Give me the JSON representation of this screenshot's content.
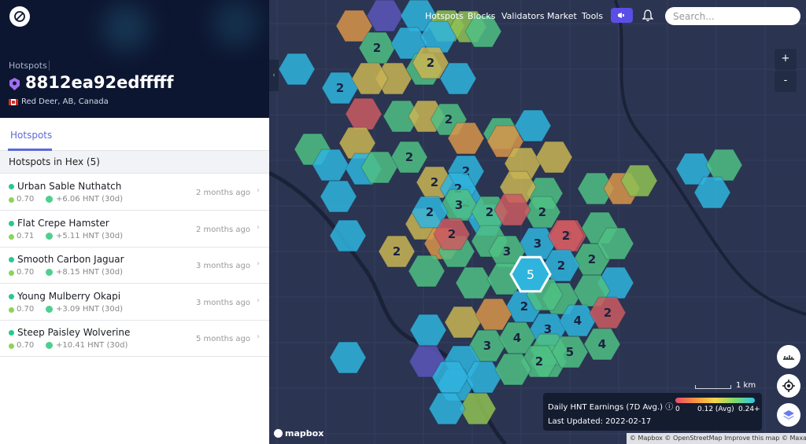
{
  "panel": {
    "breadcrumb": "Hotspots",
    "hotspot_name": "8812ea92edfffff",
    "location": "Red Deer, AB, Canada",
    "tab": "Hotspots",
    "list_title": "Hotspots in Hex (5)",
    "rows": [
      {
        "name": "Urban Sable Nuthatch",
        "scale": "0.70",
        "hnt": "+6.06 HNT (30d)",
        "age": "2 months ago"
      },
      {
        "name": "Flat Crepe Hamster",
        "scale": "0.71",
        "hnt": "+5.11 HNT (30d)",
        "age": "2 months ago"
      },
      {
        "name": "Smooth Carbon Jaguar",
        "scale": "0.70",
        "hnt": "+8.15 HNT (30d)",
        "age": "3 months ago"
      },
      {
        "name": "Young Mulberry Okapi",
        "scale": "0.70",
        "hnt": "+3.09 HNT (30d)",
        "age": "3 months ago"
      },
      {
        "name": "Steep Paisley Wolverine",
        "scale": "0.70",
        "hnt": "+10.41 HNT (30d)",
        "age": "5 months ago"
      }
    ]
  },
  "nav": {
    "items": [
      "Hotspots",
      "Blocks",
      "Validators",
      "Market",
      "Tools"
    ],
    "search_placeholder": "Search..."
  },
  "map": {
    "zoom_in": "+",
    "zoom_out": "-",
    "scale_label": "1 km",
    "legend": {
      "title": "Daily HNT Earnings (7D Avg.) ⓘ",
      "min": "0",
      "avg": "0.12 (Avg)",
      "max": "0.24+",
      "updated": "Last Updated: 2022-02-17"
    },
    "mapbox": "mapbox",
    "attribution": "© Mapbox © OpenStreetMap  Improve this map  © Maxar",
    "selected_hex_count": "5",
    "hex_colors": {
      "blue": "#2fb4de",
      "green": "#4fbf84",
      "lgreen": "#8fc154",
      "yellow": "#c9b453",
      "orange": "#d8944a",
      "red": "#cb5a62",
      "purple": "#5a56b8"
    },
    "hexes": [
      {
        "c": "orange",
        "l": ""
      },
      {
        "c": "purple",
        "l": ""
      },
      {
        "c": "blue",
        "l": ""
      },
      {
        "c": "lgreen",
        "l": ""
      },
      {
        "c": "green",
        "l": "2"
      },
      {
        "c": "blue",
        "l": ""
      },
      {
        "c": "blue",
        "l": ""
      },
      {
        "c": "lgreen",
        "l": ""
      },
      {
        "c": "blue",
        "l": ""
      },
      {
        "c": "yellow",
        "l": ""
      },
      {
        "c": "green",
        "l": ""
      },
      {
        "c": "yellow",
        "l": "2"
      },
      {
        "c": "blue",
        "l": "2"
      },
      {
        "c": "yellow",
        "l": ""
      },
      {
        "c": "blue",
        "l": ""
      },
      {
        "c": "green",
        "l": ""
      },
      {
        "c": "red",
        "l": ""
      },
      {
        "c": "green",
        "l": ""
      },
      {
        "c": "yellow",
        "l": ""
      },
      {
        "c": "green",
        "l": "2"
      },
      {
        "c": "green",
        "l": ""
      },
      {
        "c": "yellow",
        "l": ""
      },
      {
        "c": "orange",
        "l": ""
      },
      {
        "c": "green",
        "l": ""
      },
      {
        "c": "blue",
        "l": ""
      },
      {
        "c": "green",
        "l": "2"
      },
      {
        "c": "orange",
        "l": ""
      },
      {
        "c": "blue",
        "l": ""
      },
      {
        "c": "blue",
        "l": ""
      },
      {
        "c": "green",
        "l": ""
      },
      {
        "c": "blue",
        "l": "2"
      },
      {
        "c": "yellow",
        "l": ""
      },
      {
        "c": "blue",
        "l": ""
      },
      {
        "c": "yellow",
        "l": "2"
      },
      {
        "c": "blue",
        "l": "2"
      },
      {
        "c": "yellow",
        "l": ""
      },
      {
        "c": "blue",
        "l": ""
      },
      {
        "c": "green",
        "l": ""
      },
      {
        "c": "green",
        "l": ""
      },
      {
        "c": "blue",
        "l": "2"
      },
      {
        "c": "green",
        "l": "3"
      },
      {
        "c": "blue",
        "l": ""
      },
      {
        "c": "yellow",
        "l": ""
      },
      {
        "c": "green",
        "l": "2"
      },
      {
        "c": "green",
        "l": "2"
      },
      {
        "c": "yellow",
        "l": ""
      },
      {
        "c": "red",
        "l": ""
      },
      {
        "c": "red",
        "l": "2"
      },
      {
        "c": "blue",
        "l": "2"
      },
      {
        "c": "yellow",
        "l": "2"
      },
      {
        "c": "orange",
        "l": ""
      },
      {
        "c": "green",
        "l": ""
      },
      {
        "c": "green",
        "l": ""
      },
      {
        "c": "red",
        "l": "2"
      },
      {
        "c": "blue",
        "l": "3"
      },
      {
        "c": "green",
        "l": ""
      },
      {
        "c": "red",
        "l": "2"
      },
      {
        "c": "green",
        "l": "2"
      },
      {
        "c": "green",
        "l": ""
      },
      {
        "c": "green",
        "l": "3"
      },
      {
        "c": "blue",
        "l": "2"
      },
      {
        "c": "green",
        "l": ""
      },
      {
        "c": "green",
        "l": ""
      },
      {
        "c": "blue",
        "l": ""
      },
      {
        "c": "green",
        "l": ""
      },
      {
        "c": "green",
        "l": ""
      },
      {
        "c": "green",
        "l": ""
      },
      {
        "c": "blue",
        "l": "2"
      },
      {
        "c": "green",
        "l": ""
      },
      {
        "c": "blue",
        "l": "3"
      },
      {
        "c": "blue",
        "l": "4"
      },
      {
        "c": "red",
        "l": "2"
      },
      {
        "c": "blue",
        "l": ""
      },
      {
        "c": "yellow",
        "l": ""
      },
      {
        "c": "orange",
        "l": ""
      },
      {
        "c": "green",
        "l": "3"
      },
      {
        "c": "green",
        "l": "4"
      },
      {
        "c": "green",
        "l": ""
      },
      {
        "c": "green",
        "l": ""
      },
      {
        "c": "green",
        "l": "5"
      },
      {
        "c": "green",
        "l": "4"
      },
      {
        "c": "blue",
        "l": ""
      },
      {
        "c": "green",
        "l": "2"
      },
      {
        "c": "purple",
        "l": ""
      },
      {
        "c": "blue",
        "l": ""
      },
      {
        "c": "lgreen",
        "l": ""
      },
      {
        "c": "blue",
        "l": ""
      },
      {
        "c": "blue",
        "l": ""
      },
      {
        "c": "green",
        "l": ""
      },
      {
        "c": "blue",
        "l": ""
      },
      {
        "c": "blue",
        "l": ""
      },
      {
        "c": "orange",
        "l": ""
      },
      {
        "c": "lgreen",
        "l": ""
      },
      {
        "c": "blue",
        "l": ""
      },
      {
        "c": "green",
        "l": ""
      },
      {
        "c": "blue",
        "l": ""
      }
    ]
  }
}
